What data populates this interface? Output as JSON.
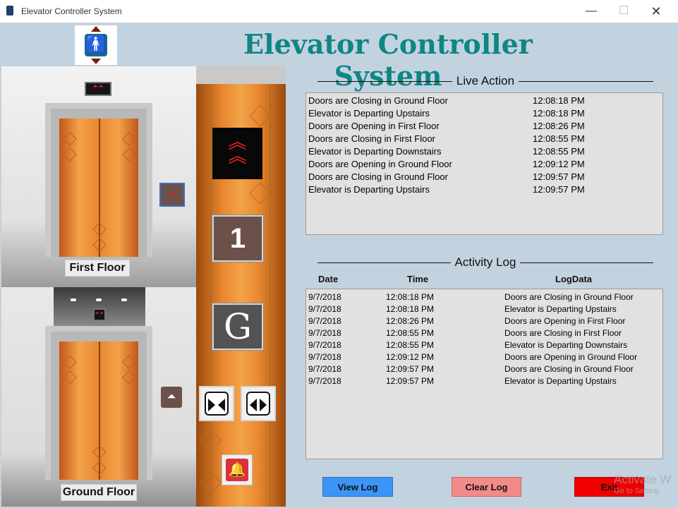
{
  "window": {
    "title": "Elevator Controller System",
    "min": "—",
    "max": "☐",
    "close": "✕"
  },
  "header": {
    "app_title": "Elevator Controller System",
    "logo_person": "🚹"
  },
  "floors": {
    "first": {
      "label": "First Floor",
      "indicator": "⏶⏶",
      "call_button": "▼"
    },
    "ground": {
      "label": "Ground Floor",
      "indicator": "⏶⏶",
      "call_button": "⏶"
    }
  },
  "car_panel": {
    "direction_glyph": "︽",
    "floor1_label": "1",
    "groundG_label": "G",
    "alarm_glyph": "🔔"
  },
  "live_action": {
    "title": "Live Action",
    "rows": [
      {
        "text": "Doors are Closing in Ground Floor",
        "time": "12:08:18 PM"
      },
      {
        "text": "Elevator is Departing Upstairs",
        "time": "12:08:18 PM"
      },
      {
        "text": "Doors are Opening in First Floor",
        "time": "12:08:26 PM"
      },
      {
        "text": "Doors are Closing in First Floor",
        "time": "12:08:55 PM"
      },
      {
        "text": "Elevator is Departing Downstairs",
        "time": "12:08:55 PM"
      },
      {
        "text": "Doors are Opening in Ground Floor",
        "time": "12:09:12 PM"
      },
      {
        "text": "Doors are Closing in Ground Floor",
        "time": "12:09:57 PM"
      },
      {
        "text": "Elevator is Departing Upstairs",
        "time": "12:09:57 PM"
      }
    ]
  },
  "activity_log": {
    "title": "Activity Log",
    "columns": {
      "date": "Date",
      "time": "Time",
      "log": "LogData"
    },
    "rows": [
      {
        "date": "9/7/2018",
        "time": "12:08:18 PM",
        "log": "Doors are Closing in Ground Floor"
      },
      {
        "date": "9/7/2018",
        "time": "12:08:18 PM",
        "log": "Elevator is Departing Upstairs"
      },
      {
        "date": "9/7/2018",
        "time": "12:08:26 PM",
        "log": "Doors are Opening in First Floor"
      },
      {
        "date": "9/7/2018",
        "time": "12:08:55 PM",
        "log": "Doors are Closing in First Floor"
      },
      {
        "date": "9/7/2018",
        "time": "12:08:55 PM",
        "log": "Elevator is Departing Downstairs"
      },
      {
        "date": "9/7/2018",
        "time": "12:09:12 PM",
        "log": "Doors are Opening in Ground Floor"
      },
      {
        "date": "9/7/2018",
        "time": "12:09:57 PM",
        "log": "Doors are Closing in Ground Floor"
      },
      {
        "date": "9/7/2018",
        "time": "12:09:57 PM",
        "log": "Elevator is Departing Upstairs"
      }
    ]
  },
  "actions": {
    "view_log": "View Log",
    "clear_log": "Clear Log",
    "exit": "Exit"
  },
  "watermark": {
    "line1": "Activate W",
    "line2": "Go to Setting"
  },
  "colors": {
    "title_teal": "#0e8683",
    "view_blue": "#3b95f6",
    "clear_pink": "#f38a8a",
    "exit_red": "#f00000"
  }
}
